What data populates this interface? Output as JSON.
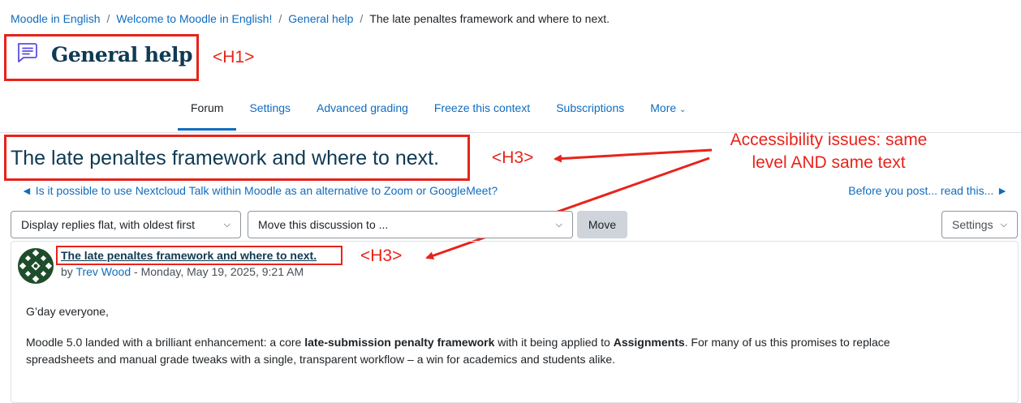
{
  "breadcrumb": {
    "items": [
      "Moodle in English",
      "Welcome to Moodle in English!",
      "General help"
    ],
    "separator": "/",
    "current": "The late penaltes framework and where to next."
  },
  "page": {
    "title": "General help",
    "forum_icon": "forum-chat-icon"
  },
  "tabs": [
    "Forum",
    "Settings",
    "Advanced grading",
    "Freeze this context",
    "Subscriptions"
  ],
  "tabs_more": "More",
  "discussion": {
    "title": "The late penaltes framework and where to next.",
    "prev_link": "◄ Is it possible to use Nextcloud Talk within Moodle as an alternative to Zoom or GoogleMeet?",
    "next_link": "Before you post... read this... ►"
  },
  "controls": {
    "display_mode": "Display replies flat, with oldest first",
    "move_select": "Move this discussion to ...",
    "move_button": "Move",
    "settings": "Settings"
  },
  "post": {
    "title": "The late penaltes framework and where to next.",
    "by_prefix": "by",
    "author": "Trev Wood",
    "date": "- Monday, May 19, 2025, 9:21 AM",
    "greeting": "G’day everyone,",
    "p1_a": "Moodle 5.0 landed with a brilliant enhancement: a core ",
    "p1_b": "late-submission penalty framework",
    "p1_c": " with it being applied to ",
    "p1_d": "Assignments",
    "p1_e": ". For many of us this promises to replace",
    "p2": "spreadsheets and manual grade tweaks with a single, transparent workflow – a win for academics and students alike."
  },
  "annotations": {
    "h1_label": "<H1>",
    "h3_label_top": "<H3>",
    "h3_label_post": "<H3>",
    "note_line1": "Accessibility issues: same",
    "note_line2": "level AND same text"
  },
  "colors": {
    "annotation_red": "#e8231b",
    "link_blue": "#0f6cbf",
    "heading": "#0f3a52",
    "icon_purple": "#5b4ee0"
  }
}
